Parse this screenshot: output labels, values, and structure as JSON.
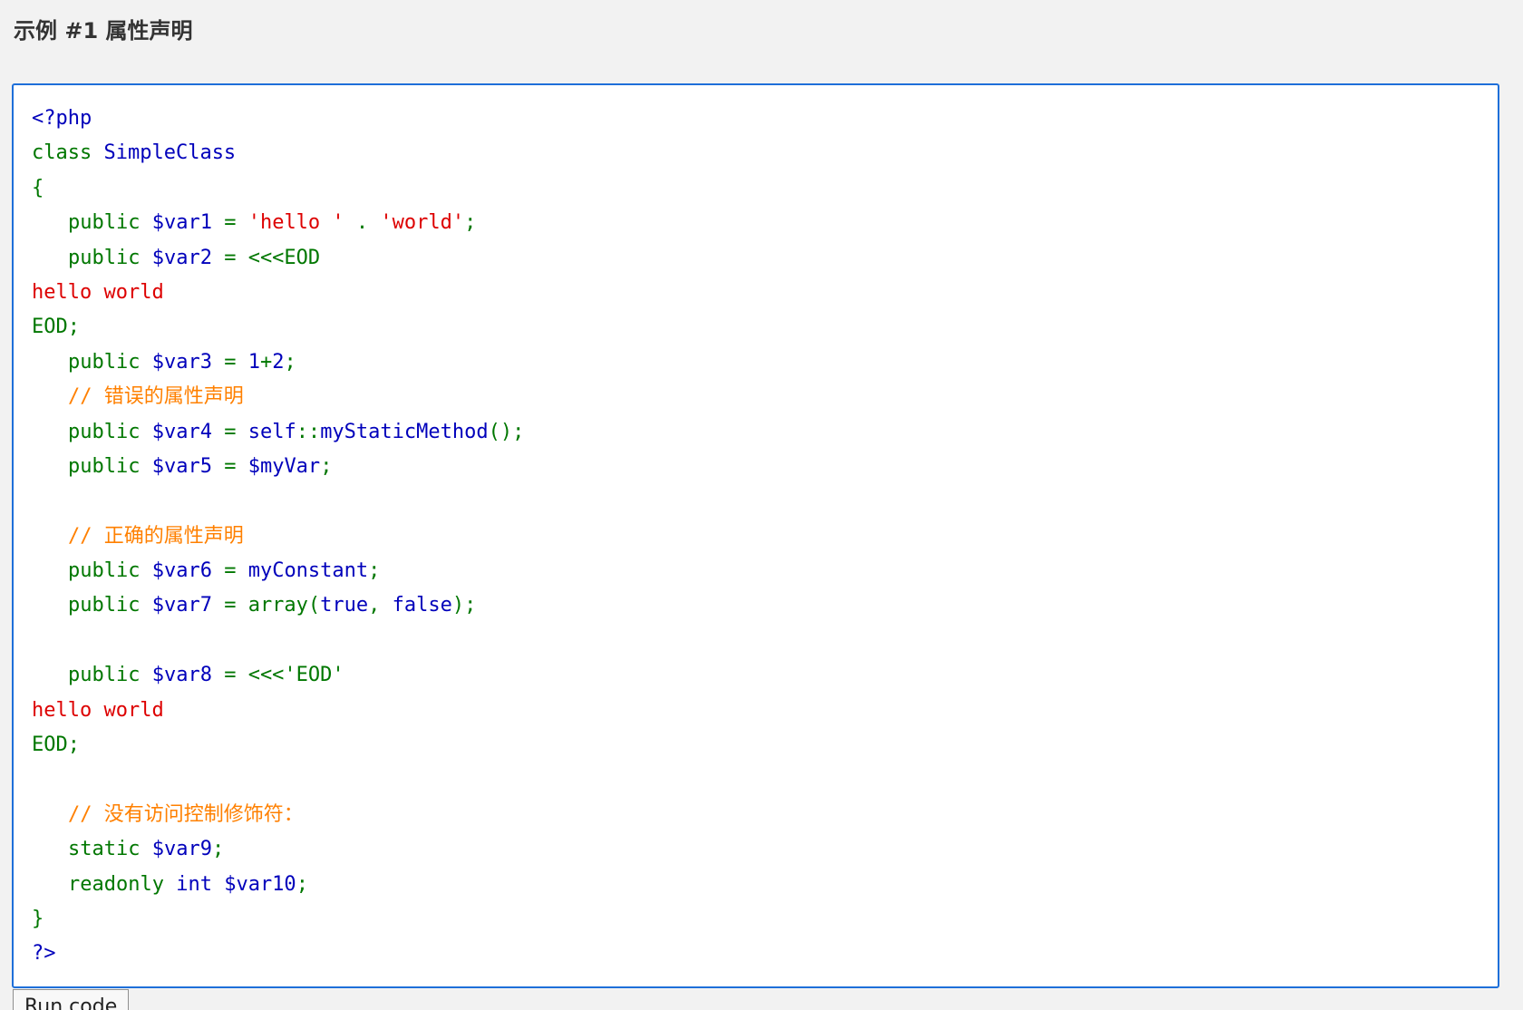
{
  "example": {
    "title": "示例 #1 属性声明"
  },
  "code": {
    "language": "php",
    "lines": [
      [
        {
          "t": "<?php",
          "c": "b"
        }
      ],
      [
        {
          "t": "class ",
          "c": "k"
        },
        {
          "t": "SimpleClass",
          "c": "b"
        }
      ],
      [
        {
          "t": "{",
          "c": "k"
        }
      ],
      [
        {
          "i": 1
        },
        {
          "t": "public ",
          "c": "k"
        },
        {
          "t": "$var1 ",
          "c": "b"
        },
        {
          "t": "= ",
          "c": "k"
        },
        {
          "t": "'hello ' ",
          "c": "s"
        },
        {
          "t": ". ",
          "c": "k"
        },
        {
          "t": "'world'",
          "c": "s"
        },
        {
          "t": ";",
          "c": "k"
        }
      ],
      [
        {
          "i": 1
        },
        {
          "t": "public ",
          "c": "k"
        },
        {
          "t": "$var2 ",
          "c": "b"
        },
        {
          "t": "= <<<EOD",
          "c": "k"
        }
      ],
      [
        {
          "t": "hello world",
          "c": "s"
        }
      ],
      [
        {
          "t": "EOD;",
          "c": "k"
        }
      ],
      [
        {
          "i": 1
        },
        {
          "t": "public ",
          "c": "k"
        },
        {
          "t": "$var3 ",
          "c": "b"
        },
        {
          "t": "= ",
          "c": "k"
        },
        {
          "t": "1",
          "c": "b"
        },
        {
          "t": "+",
          "c": "k"
        },
        {
          "t": "2",
          "c": "b"
        },
        {
          "t": ";",
          "c": "k"
        }
      ],
      [
        {
          "i": 1
        },
        {
          "t": "// 错误的属性声明",
          "c": "c"
        }
      ],
      [
        {
          "i": 1
        },
        {
          "t": "public ",
          "c": "k"
        },
        {
          "t": "$var4 ",
          "c": "b"
        },
        {
          "t": "= ",
          "c": "k"
        },
        {
          "t": "self",
          "c": "b"
        },
        {
          "t": "::",
          "c": "k"
        },
        {
          "t": "myStaticMethod",
          "c": "b"
        },
        {
          "t": "();",
          "c": "k"
        }
      ],
      [
        {
          "i": 1
        },
        {
          "t": "public ",
          "c": "k"
        },
        {
          "t": "$var5 ",
          "c": "b"
        },
        {
          "t": "= ",
          "c": "k"
        },
        {
          "t": "$myVar",
          "c": "b"
        },
        {
          "t": ";",
          "c": "k"
        }
      ],
      [],
      [
        {
          "i": 1
        },
        {
          "t": "// 正确的属性声明",
          "c": "c"
        }
      ],
      [
        {
          "i": 1
        },
        {
          "t": "public ",
          "c": "k"
        },
        {
          "t": "$var6 ",
          "c": "b"
        },
        {
          "t": "= ",
          "c": "k"
        },
        {
          "t": "myConstant",
          "c": "b"
        },
        {
          "t": ";",
          "c": "k"
        }
      ],
      [
        {
          "i": 1
        },
        {
          "t": "public ",
          "c": "k"
        },
        {
          "t": "$var7 ",
          "c": "b"
        },
        {
          "t": "= array(",
          "c": "k"
        },
        {
          "t": "true",
          "c": "b"
        },
        {
          "t": ", ",
          "c": "k"
        },
        {
          "t": "false",
          "c": "b"
        },
        {
          "t": ");",
          "c": "k"
        }
      ],
      [],
      [
        {
          "i": 1
        },
        {
          "t": "public ",
          "c": "k"
        },
        {
          "t": "$var8 ",
          "c": "b"
        },
        {
          "t": "= <<<'EOD'",
          "c": "k"
        }
      ],
      [
        {
          "t": "hello world",
          "c": "s"
        }
      ],
      [
        {
          "t": "EOD;",
          "c": "k"
        }
      ],
      [],
      [
        {
          "i": 1
        },
        {
          "t": "// 没有访问控制修饰符：",
          "c": "c"
        }
      ],
      [
        {
          "i": 1
        },
        {
          "t": "static ",
          "c": "k"
        },
        {
          "t": "$var9",
          "c": "b"
        },
        {
          "t": ";",
          "c": "k"
        }
      ],
      [
        {
          "i": 1
        },
        {
          "t": "readonly ",
          "c": "k"
        },
        {
          "t": "int ",
          "c": "b"
        },
        {
          "t": "$var10",
          "c": "b"
        },
        {
          "t": ";",
          "c": "k"
        }
      ],
      [
        {
          "t": "}",
          "c": "k"
        }
      ],
      [
        {
          "t": "?>",
          "c": "b"
        }
      ]
    ]
  },
  "actions": {
    "run_label": "Run code"
  },
  "colors": {
    "keyword": "#007700",
    "default": "#0000bb",
    "string": "#dd0000",
    "comment": "#ff8000",
    "border": "#1e6fd9"
  }
}
